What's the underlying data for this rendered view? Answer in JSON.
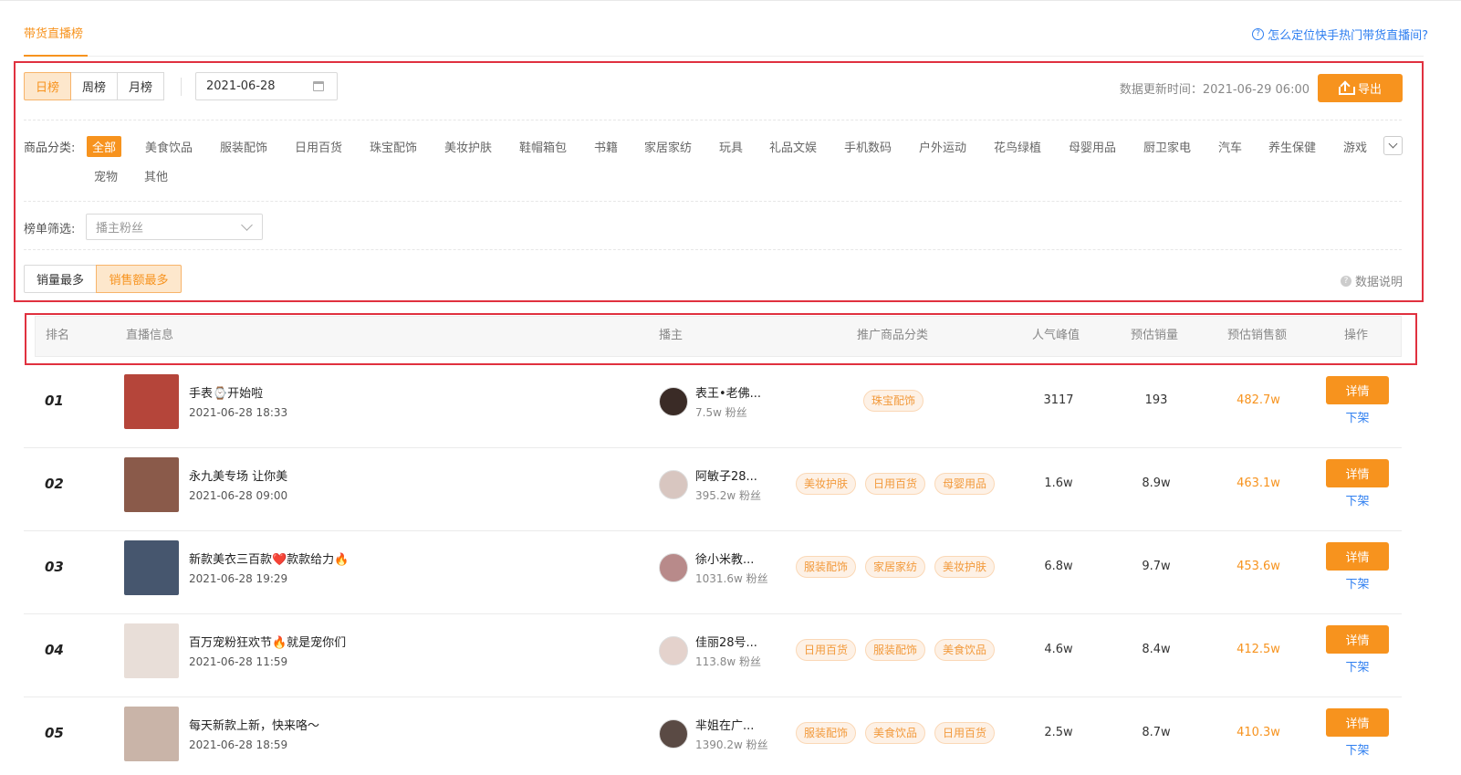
{
  "header": {
    "tab_title": "带货直播榜",
    "help_link": "怎么定位快手热门带货直播间?"
  },
  "period_tabs": [
    "日榜",
    "周榜",
    "月榜"
  ],
  "active_period": 0,
  "date_value": "2021-06-28",
  "update_time": "数据更新时间：2021-06-29 06:00",
  "export_label": "导出",
  "category": {
    "label": "商品分类:",
    "items": [
      "全部",
      "美食饮品",
      "服装配饰",
      "日用百货",
      "珠宝配饰",
      "美妆护肤",
      "鞋帽箱包",
      "书籍",
      "家居家纺",
      "玩具",
      "礼品文娱",
      "手机数码",
      "户外运动",
      "花鸟绿植",
      "母婴用品",
      "厨卫家电",
      "汽车",
      "养生保健",
      "游戏",
      "宠物",
      "其他"
    ]
  },
  "list_filter": {
    "label": "榜单筛选:",
    "placeholder": "播主粉丝"
  },
  "sort_tabs": [
    "销量最多",
    "销售额最多"
  ],
  "active_sort": 1,
  "data_note": "数据说明",
  "table": {
    "columns": [
      "排名",
      "直播信息",
      "播主",
      "推广商品分类",
      "人气峰值",
      "预估销量",
      "预估销售额",
      "操作"
    ],
    "detail_label": "详情",
    "off_label": "下架",
    "rows": [
      {
        "rank": "01",
        "title": "手表⌚开始啦",
        "time": "2021-06-28 18:33",
        "host": "表王•老佛...",
        "fans": "7.5w 粉丝",
        "tags": [
          "珠宝配饰"
        ],
        "peak": "3117",
        "sales": "193",
        "amount": "482.7w"
      },
      {
        "rank": "02",
        "title": "永九美专场 让你美",
        "time": "2021-06-28 09:00",
        "host": "阿敏子28...",
        "fans": "395.2w 粉丝",
        "tags": [
          "美妆护肤",
          "日用百货",
          "母婴用品"
        ],
        "peak": "1.6w",
        "sales": "8.9w",
        "amount": "463.1w"
      },
      {
        "rank": "03",
        "title": "新款美衣三百款❤️款款给力🔥",
        "time": "2021-06-28 19:29",
        "host": "徐小米教...",
        "fans": "1031.6w 粉丝",
        "tags": [
          "服装配饰",
          "家居家纺",
          "美妆护肤"
        ],
        "peak": "6.8w",
        "sales": "9.7w",
        "amount": "453.6w"
      },
      {
        "rank": "04",
        "title": "百万宠粉狂欢节🔥就是宠你们",
        "time": "2021-06-28 11:59",
        "host": "佳丽28号...",
        "fans": "113.8w 粉丝",
        "tags": [
          "日用百货",
          "服装配饰",
          "美食饮品"
        ],
        "peak": "4.6w",
        "sales": "8.4w",
        "amount": "412.5w"
      },
      {
        "rank": "05",
        "title": "每天新款上新，快来咯～",
        "time": "2021-06-28 18:59",
        "host": "芈姐在广...",
        "fans": "1390.2w 粉丝",
        "tags": [
          "服装配饰",
          "美食饮品",
          "日用百货"
        ],
        "peak": "2.5w",
        "sales": "8.7w",
        "amount": "410.3w"
      }
    ]
  },
  "colors": {
    "accent": "#f7931e",
    "link": "#2f7ff0",
    "highlight_box": "#e0313f"
  }
}
